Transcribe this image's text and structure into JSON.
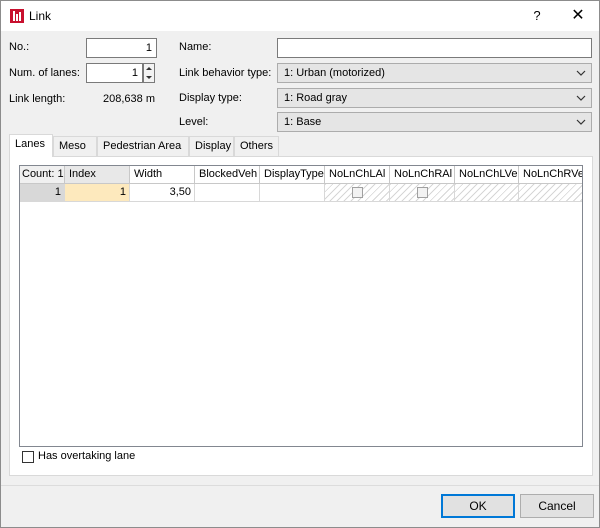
{
  "window": {
    "title": "Link",
    "help_label": "?",
    "close_label": "✕"
  },
  "form": {
    "no_label": "No.:",
    "no_value": "1",
    "num_lanes_label": "Num. of lanes:",
    "num_lanes_value": "1",
    "link_length_label": "Link length:",
    "link_length_value": "208,638 m",
    "name_label": "Name:",
    "name_value": "",
    "behavior_label": "Link behavior type:",
    "behavior_value": "1: Urban (motorized)",
    "display_type_label": "Display type:",
    "display_type_value": "1: Road gray",
    "level_label": "Level:",
    "level_value": "1: Base"
  },
  "tabs": [
    "Lanes",
    "Meso",
    "Pedestrian Area",
    "Display",
    "Others"
  ],
  "grid": {
    "count_label": "Count: 1",
    "columns": [
      "Index",
      "Width",
      "BlockedVeh",
      "DisplayType",
      "NoLnChLAl",
      "NoLnChRAl",
      "NoLnChLVe",
      "NoLnChRVe"
    ],
    "row": {
      "row_header": "1",
      "index": "1",
      "width": "3,50",
      "blocked_veh": "",
      "display_type": ""
    }
  },
  "options": {
    "has_overtaking_lane_label": "Has overtaking lane",
    "has_overtaking_lane_checked": false
  },
  "buttons": {
    "ok_label": "OK",
    "cancel_label": "Cancel"
  },
  "colors": {
    "accent": "#0078d7",
    "selected_cell": "#fde9bd",
    "app_icon": "#c8102e"
  }
}
